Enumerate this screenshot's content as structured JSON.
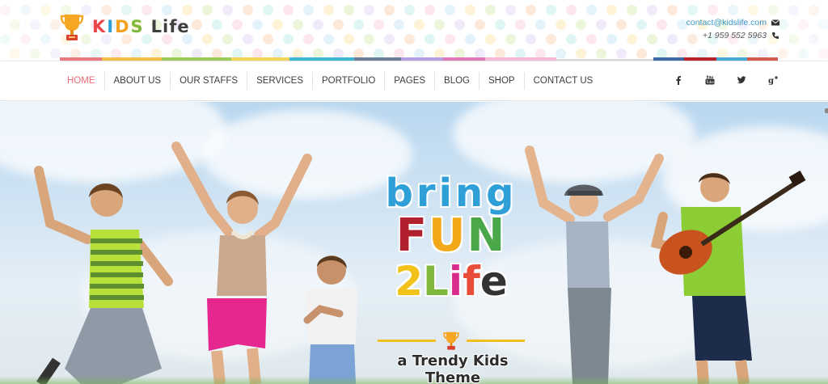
{
  "brand": {
    "logo_part1": "KIDS",
    "logo_part2": "Life",
    "icon": "trophy-icon"
  },
  "contact": {
    "email": "contact@kidslife.com",
    "phone": "+1 959 552 5963",
    "email_icon": "envelope-icon",
    "phone_icon": "phone-icon"
  },
  "nav": {
    "items": [
      {
        "label": "HOME",
        "active": true
      },
      {
        "label": "ABOUT US"
      },
      {
        "label": "OUR STAFFS"
      },
      {
        "label": "SERVICES"
      },
      {
        "label": "PORTFOLIO"
      },
      {
        "label": "PAGES"
      },
      {
        "label": "BLOG"
      },
      {
        "label": "SHOP"
      },
      {
        "label": "CONTACT US"
      }
    ],
    "active_color": "#e86d78"
  },
  "social": [
    "facebook-icon",
    "youtube-icon",
    "twitter-icon",
    "google-plus-icon"
  ],
  "hero": {
    "line1": "bring",
    "line2": "FUN",
    "line3": "2Life",
    "subtitle": "a Trendy Kids Theme",
    "divider_icon": "trophy-icon"
  },
  "colors": {
    "stripe": [
      "#e87a80",
      "#f3bf4a",
      "#9ccb5a",
      "#f2d55a",
      "#3fb6d2",
      "#6a7f9a",
      "#b79de3",
      "#e07ab8",
      "#f6b8d6",
      "#3e6aa8",
      "#b8222a",
      "#46a9d6",
      "#d35a4e"
    ]
  }
}
